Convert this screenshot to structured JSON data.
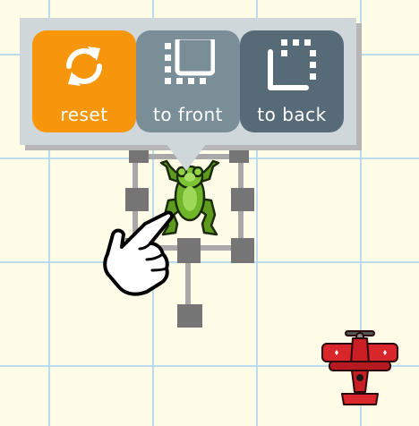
{
  "toolbar": {
    "reset_label": "reset",
    "front_label": "to front",
    "back_label": "to back"
  },
  "icons": {
    "reset": "refresh-icon",
    "front": "bring-to-front-icon",
    "back": "send-to-back-icon"
  },
  "sprites": {
    "selected": "frog-sprite",
    "other": "red-biplane-sprite"
  },
  "colors": {
    "background": "#fffde8",
    "grid": "#b9dcf0",
    "reset_button": "#f7960b",
    "front_button": "#7a8e98",
    "back_button": "#566b77",
    "toolbar": "#cfd7da",
    "handles": "#757575"
  }
}
